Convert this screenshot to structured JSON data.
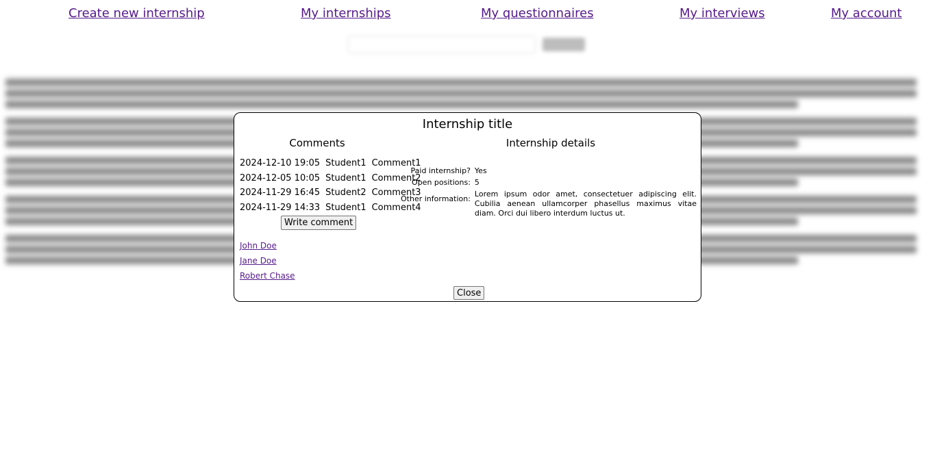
{
  "nav": {
    "create": "Create new internship",
    "internships": "My internships",
    "questionnaires": "My questionnaires",
    "interviews": "My interviews",
    "account": "My account"
  },
  "modal": {
    "title": "Internship title",
    "comments_title": "Comments",
    "details_title": "Internship details",
    "comments": [
      {
        "date": "2024-12-10 19:05",
        "author": "Student1",
        "text": "Comment1"
      },
      {
        "date": "2024-12-05 10:05",
        "author": "Student1",
        "text": "Comment2"
      },
      {
        "date": "2024-11-29 16:45",
        "author": "Student2",
        "text": "Comment3"
      },
      {
        "date": "2024-11-29 14:33",
        "author": "Student1",
        "text": "Comment4"
      }
    ],
    "write_comment": "Write comment",
    "people": [
      "John Doe",
      "Jane Doe",
      "Robert Chase"
    ],
    "details": {
      "paid_label": "Paid internship?",
      "paid_value": "Yes",
      "positions_label": "Open positions:",
      "positions_value": "5",
      "other_label": "Other information:",
      "other_value": "Lorem ipsum odor amet, consectetuer adipiscing elit. Cubilia aenean ullamcorper phasellus maximus vitae diam. Orci dui libero interdum luctus ut."
    },
    "close": "Close"
  },
  "colors": {
    "link": "#551a8b",
    "border": "#000000"
  }
}
